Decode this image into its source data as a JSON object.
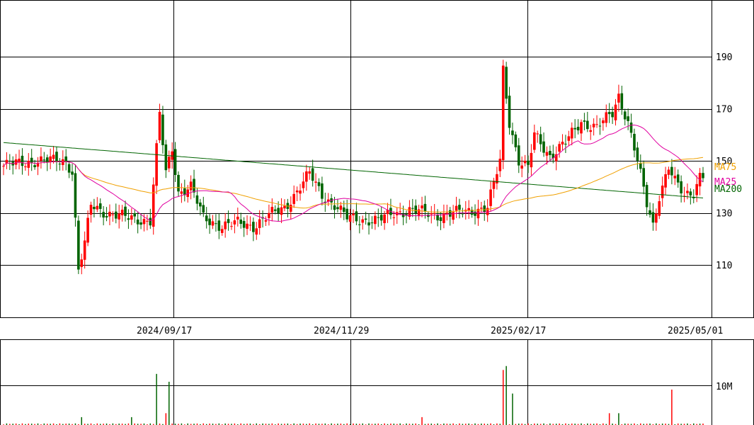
{
  "chart_data": [
    {
      "type": "candlestick",
      "x_tick_labels": [
        "2024/09/17",
        "2024/11/29",
        "2025/02/17",
        "2025/05/01"
      ],
      "y_ticks": [
        110,
        130,
        150,
        170,
        190
      ],
      "ylim": [
        90,
        210
      ],
      "legend": [
        "MA75",
        "MA25",
        "MA200"
      ],
      "colors": {
        "up": "#ff0000",
        "down": "#006400",
        "ma75": "#f0a000",
        "ma25": "#e000a0",
        "ma200": "#006400",
        "grid": "#000000"
      },
      "anchors": [
        {
          "i": 0,
          "c": 148
        },
        {
          "i": 10,
          "c": 150
        },
        {
          "i": 20,
          "c": 150
        },
        {
          "i": 22,
          "c": 146
        },
        {
          "i": 24,
          "c": 108
        },
        {
          "i": 26,
          "c": 118
        },
        {
          "i": 28,
          "c": 133
        },
        {
          "i": 33,
          "c": 130
        },
        {
          "i": 40,
          "c": 128
        },
        {
          "i": 47,
          "c": 127
        },
        {
          "i": 50,
          "c": 168
        },
        {
          "i": 52,
          "c": 145
        },
        {
          "i": 54,
          "c": 155
        },
        {
          "i": 56,
          "c": 138
        },
        {
          "i": 60,
          "c": 140
        },
        {
          "i": 64,
          "c": 128
        },
        {
          "i": 70,
          "c": 125
        },
        {
          "i": 75,
          "c": 126
        },
        {
          "i": 80,
          "c": 125
        },
        {
          "i": 85,
          "c": 129
        },
        {
          "i": 90,
          "c": 132
        },
        {
          "i": 95,
          "c": 140
        },
        {
          "i": 98,
          "c": 145
        },
        {
          "i": 102,
          "c": 137
        },
        {
          "i": 106,
          "c": 133
        },
        {
          "i": 110,
          "c": 128
        },
        {
          "i": 120,
          "c": 127
        },
        {
          "i": 125,
          "c": 130
        },
        {
          "i": 130,
          "c": 131
        },
        {
          "i": 140,
          "c": 129
        },
        {
          "i": 150,
          "c": 131
        },
        {
          "i": 155,
          "c": 132
        },
        {
          "i": 159,
          "c": 150
        },
        {
          "i": 160,
          "c": 185
        },
        {
          "i": 162,
          "c": 165
        },
        {
          "i": 165,
          "c": 150
        },
        {
          "i": 168,
          "c": 147
        },
        {
          "i": 170,
          "c": 160
        },
        {
          "i": 175,
          "c": 152
        },
        {
          "i": 180,
          "c": 157
        },
        {
          "i": 185,
          "c": 165
        },
        {
          "i": 190,
          "c": 163
        },
        {
          "i": 195,
          "c": 168
        },
        {
          "i": 197,
          "c": 175
        },
        {
          "i": 200,
          "c": 165
        },
        {
          "i": 203,
          "c": 150
        },
        {
          "i": 206,
          "c": 133
        },
        {
          "i": 208,
          "c": 125
        },
        {
          "i": 210,
          "c": 137
        },
        {
          "i": 213,
          "c": 148
        },
        {
          "i": 215,
          "c": 142
        },
        {
          "i": 218,
          "c": 136
        },
        {
          "i": 221,
          "c": 138
        },
        {
          "i": 223,
          "c": 145
        }
      ],
      "volume_spikes": [
        {
          "i": 25,
          "v": 2
        },
        {
          "i": 41,
          "v": 2
        },
        {
          "i": 49,
          "v": 13
        },
        {
          "i": 52,
          "v": 3
        },
        {
          "i": 53,
          "v": 11
        },
        {
          "i": 134,
          "v": 2
        },
        {
          "i": 160,
          "v": 14
        },
        {
          "i": 161,
          "v": 15
        },
        {
          "i": 163,
          "v": 8
        },
        {
          "i": 194,
          "v": 3
        },
        {
          "i": 197,
          "v": 3
        },
        {
          "i": 214,
          "v": 9
        }
      ],
      "y_tick_volume": [
        "10M"
      ]
    }
  ]
}
